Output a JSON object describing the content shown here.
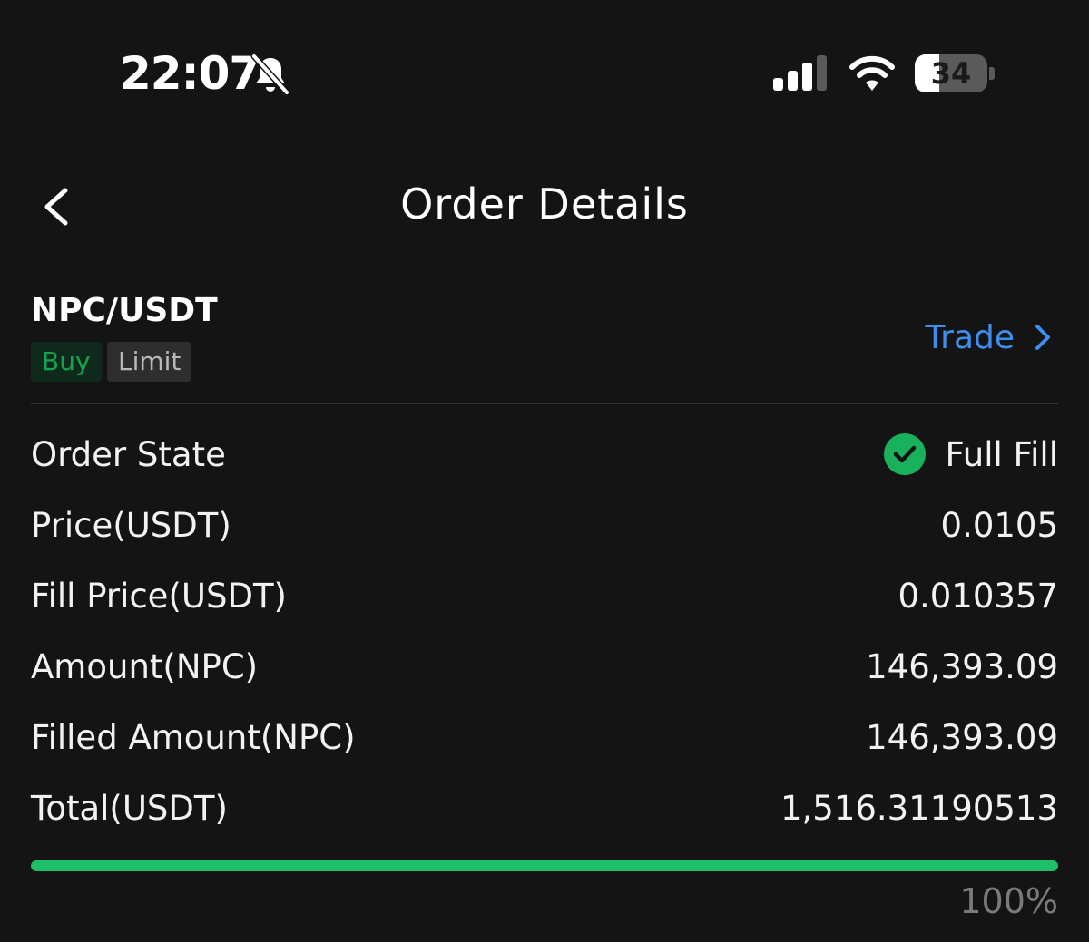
{
  "colors": {
    "background": "#141414",
    "buy_green": "#14a44d",
    "success_green": "#19b15c",
    "progress_green": "#1fbf6a",
    "link_blue": "#3d8ef0"
  },
  "status_bar": {
    "time": "22:07",
    "silent_icon": "bell-off-icon",
    "signal_icon": "cellular-signal-icon",
    "wifi_icon": "wifi-icon",
    "battery_level": "34",
    "battery_fraction": 0.34
  },
  "header": {
    "back_icon": "chevron-left-icon",
    "title": "Order Details"
  },
  "order": {
    "pair": "NPC/USDT",
    "side_tag": "Buy",
    "type_tag": "Limit",
    "trade_link": "Trade",
    "trade_icon": "chevron-right-icon"
  },
  "details": {
    "state": {
      "label": "Order State",
      "value": "Full Fill",
      "icon": "check-circle-icon"
    },
    "price": {
      "label": "Price(USDT)",
      "value": "0.0105"
    },
    "fill_price": {
      "label": "Fill Price(USDT)",
      "value": "0.010357"
    },
    "amount": {
      "label": "Amount(NPC)",
      "value": "146,393.09"
    },
    "filled_amount": {
      "label": "Filled Amount(NPC)",
      "value": "146,393.09"
    },
    "total": {
      "label": "Total(USDT)",
      "value": "1,516.31190513"
    }
  },
  "progress": {
    "percent_label": "100%",
    "fraction": 1.0
  }
}
